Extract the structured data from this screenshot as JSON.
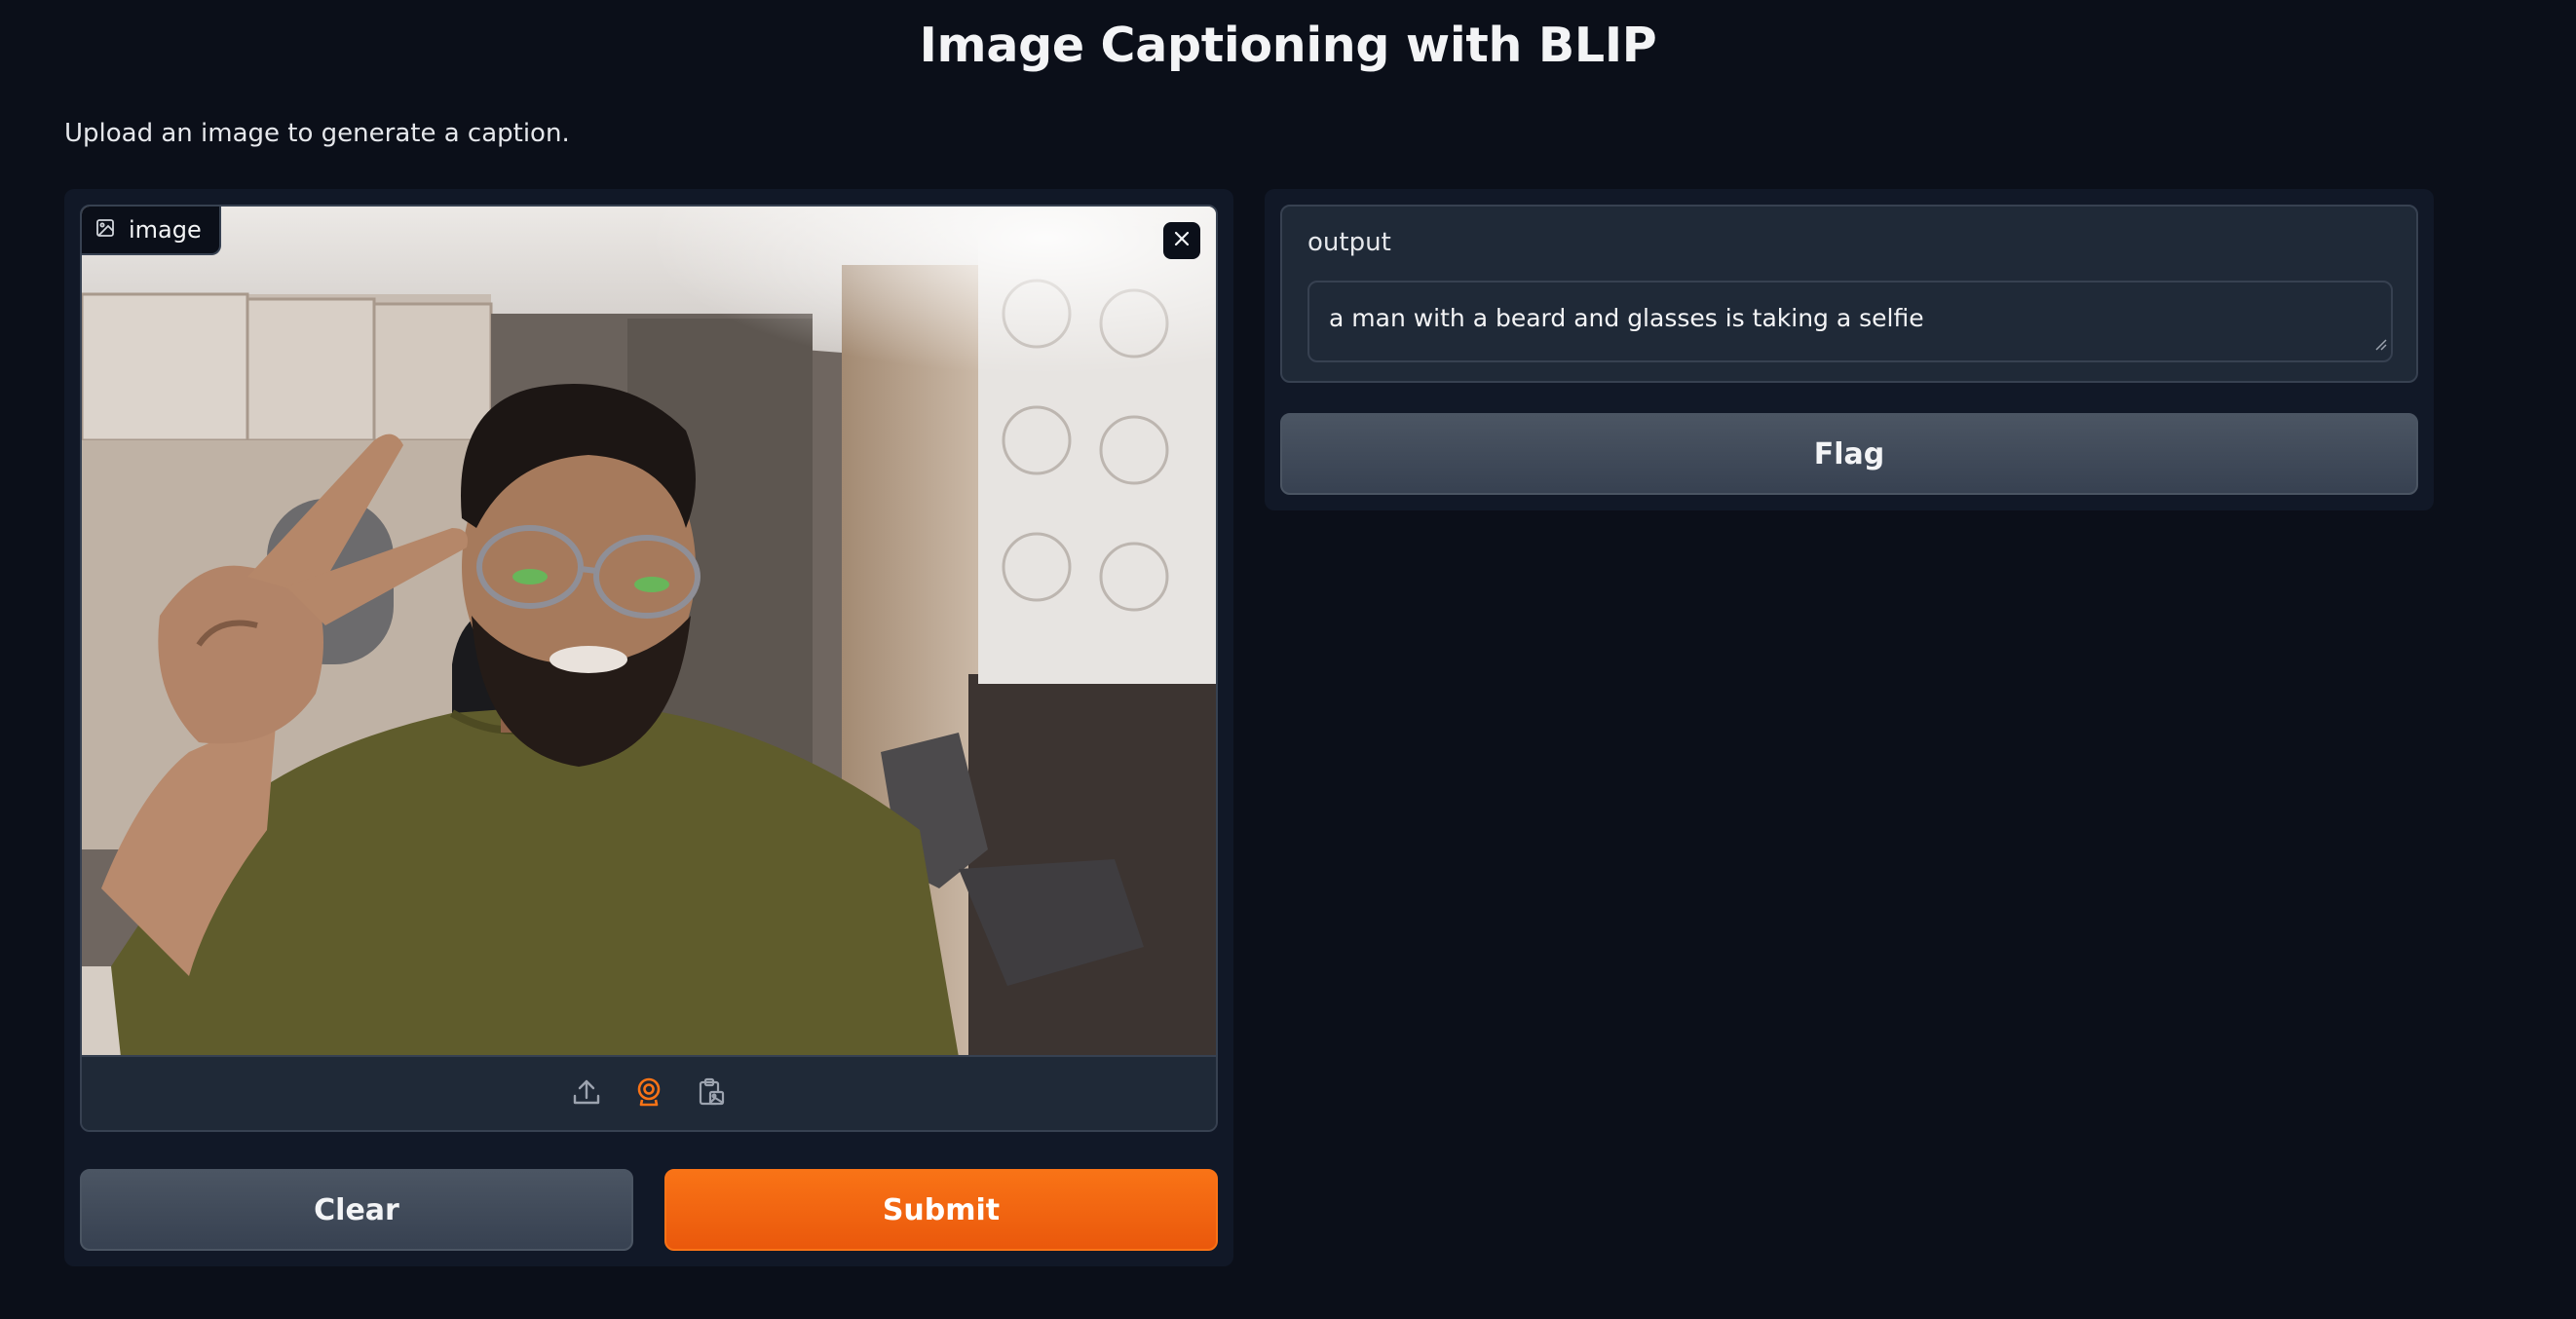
{
  "header": {
    "title": "Image Captioning with BLIP",
    "description": "Upload an image to generate a caption."
  },
  "input": {
    "image_label": "image",
    "icons": {
      "label": "image-icon",
      "close": "close-icon",
      "upload": "upload-icon",
      "webcam": "webcam-icon",
      "clipboard": "clipboard-icon"
    },
    "active_source": "webcam"
  },
  "actions": {
    "clear_label": "Clear",
    "submit_label": "Submit"
  },
  "output": {
    "label": "output",
    "value": "a man with a beard and glasses is taking a selfie",
    "flag_label": "Flag"
  },
  "colors": {
    "background": "#0b0f19",
    "panel": "#111827",
    "block": "#1f2937",
    "border": "#374151",
    "accent": "#f97316",
    "secondary_button": "#4b5563"
  }
}
